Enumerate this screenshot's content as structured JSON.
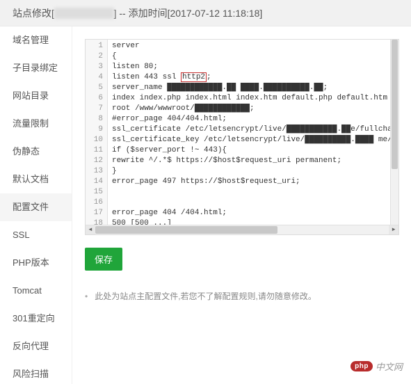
{
  "title": {
    "prefix": "站点修改[",
    "domain_obscured": "xxxxxxxx.xxe",
    "suffix": "] -- 添加时间[2017-07-12 11:18:18]"
  },
  "sidebar": {
    "items": [
      "域名管理",
      "子目录绑定",
      "网站目录",
      "流量限制",
      "伪静态",
      "默认文档",
      "配置文件",
      "SSL",
      "PHP版本",
      "Tomcat",
      "301重定向",
      "反向代理",
      "风险扫描"
    ],
    "active_index": 6
  },
  "editor": {
    "highlight_token": "http2",
    "lines": [
      "server",
      "{",
      "    listen 80;",
      "    listen 443 ssl {HL};",
      "    server_name ████████████.██ ████.██████████.██;",
      "    index index.php index.html index.htm default.php default.htm defau",
      "    root /www/wwwroot/████████████;",
      "    #error_page 404/404.html;",
      "    ssl_certificate    /etc/letsencrypt/live/███████████.██e/fullchain.pem",
      "    ssl_certificate_key    /etc/letsencrypt/live/██████████.████ me/privkey.p",
      "    if ($server_port !~ 443){",
      "        rewrite ^/.*$ https://$host$request_uri permanent;",
      "    }",
      "    error_page 497  https://$host$request_uri;",
      "",
      "",
      "    error_page 404 /404.html;",
      "        500 [500 ...]"
    ]
  },
  "buttons": {
    "save": "保存"
  },
  "footer": {
    "note": "此处为站点主配置文件,若您不了解配置规则,请勿随意修改。"
  },
  "watermark": {
    "badge": "php",
    "text": "中文网"
  }
}
